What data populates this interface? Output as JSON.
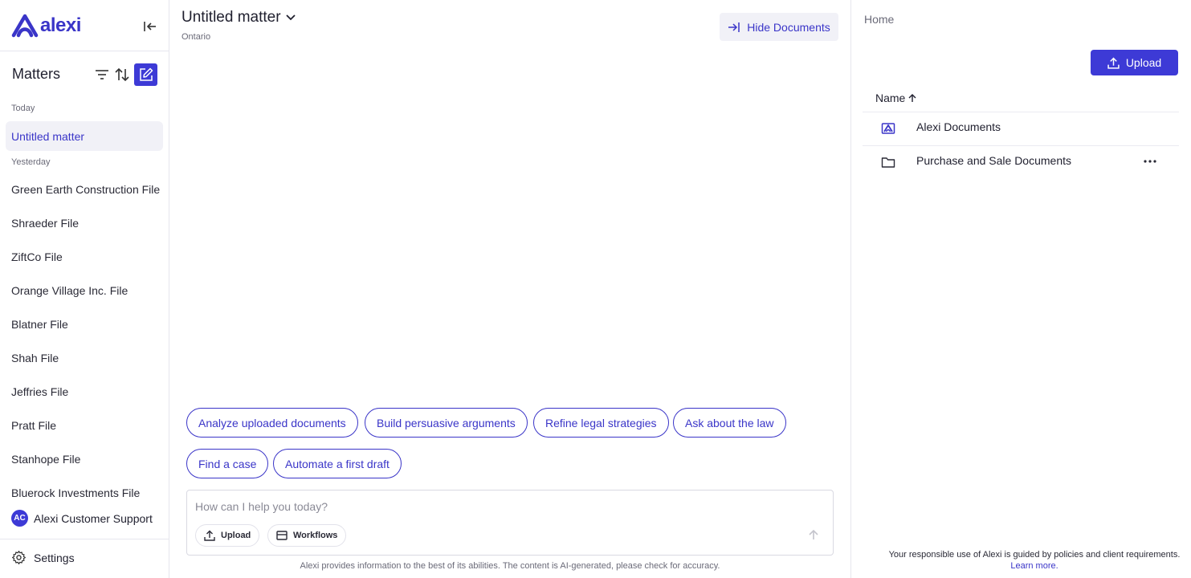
{
  "brand": {
    "name": "alexi",
    "accent": "#3d3ad6"
  },
  "sidebar": {
    "title": "Matters",
    "groups": [
      {
        "label": "Today"
      },
      {
        "label": "Yesterday"
      }
    ],
    "items": [
      {
        "label": "Untitled matter",
        "active": true
      },
      {
        "label": "Green Earth Construction File"
      },
      {
        "label": "Shraeder File"
      },
      {
        "label": "ZiftCo File"
      },
      {
        "label": "Orange Village Inc. File"
      },
      {
        "label": "Blatner File"
      },
      {
        "label": "Shah File"
      },
      {
        "label": "Jeffries File"
      },
      {
        "label": "Pratt File"
      },
      {
        "label": "Stanhope File"
      },
      {
        "label": "Bluerock Investments File"
      }
    ],
    "support": {
      "initials": "AC",
      "label": "Alexi Customer Support"
    },
    "settings_label": "Settings",
    "icons": [
      "collapse-icon",
      "filter-icon",
      "sort-icon",
      "edit-icon",
      "gear-icon"
    ]
  },
  "main": {
    "matter_title": "Untitled matter",
    "matter_subtitle": "Ontario",
    "hide_documents_label": "Hide Documents",
    "suggestions": [
      "Analyze uploaded documents",
      "Build persuasive arguments",
      "Refine legal strategies",
      "Ask about the law",
      "Find a case",
      "Automate a first draft"
    ],
    "composer": {
      "placeholder": "How can I help you today?",
      "upload_label": "Upload",
      "workflows_label": "Workflows"
    },
    "disclaimer": "Alexi provides information to the best of its abilities. The content is AI-generated, please check for accuracy."
  },
  "documents": {
    "breadcrumb": "Home",
    "upload_label": "Upload",
    "column_name": "Name",
    "sort": "ascending",
    "rows": [
      {
        "name": "Alexi Documents",
        "icon": "alexi-folder-icon"
      },
      {
        "name": "Purchase and Sale Documents",
        "icon": "folder-icon"
      }
    ],
    "notice_text": "Your responsible use of Alexi is guided by policies and client requirements.",
    "notice_link": "Learn more."
  }
}
